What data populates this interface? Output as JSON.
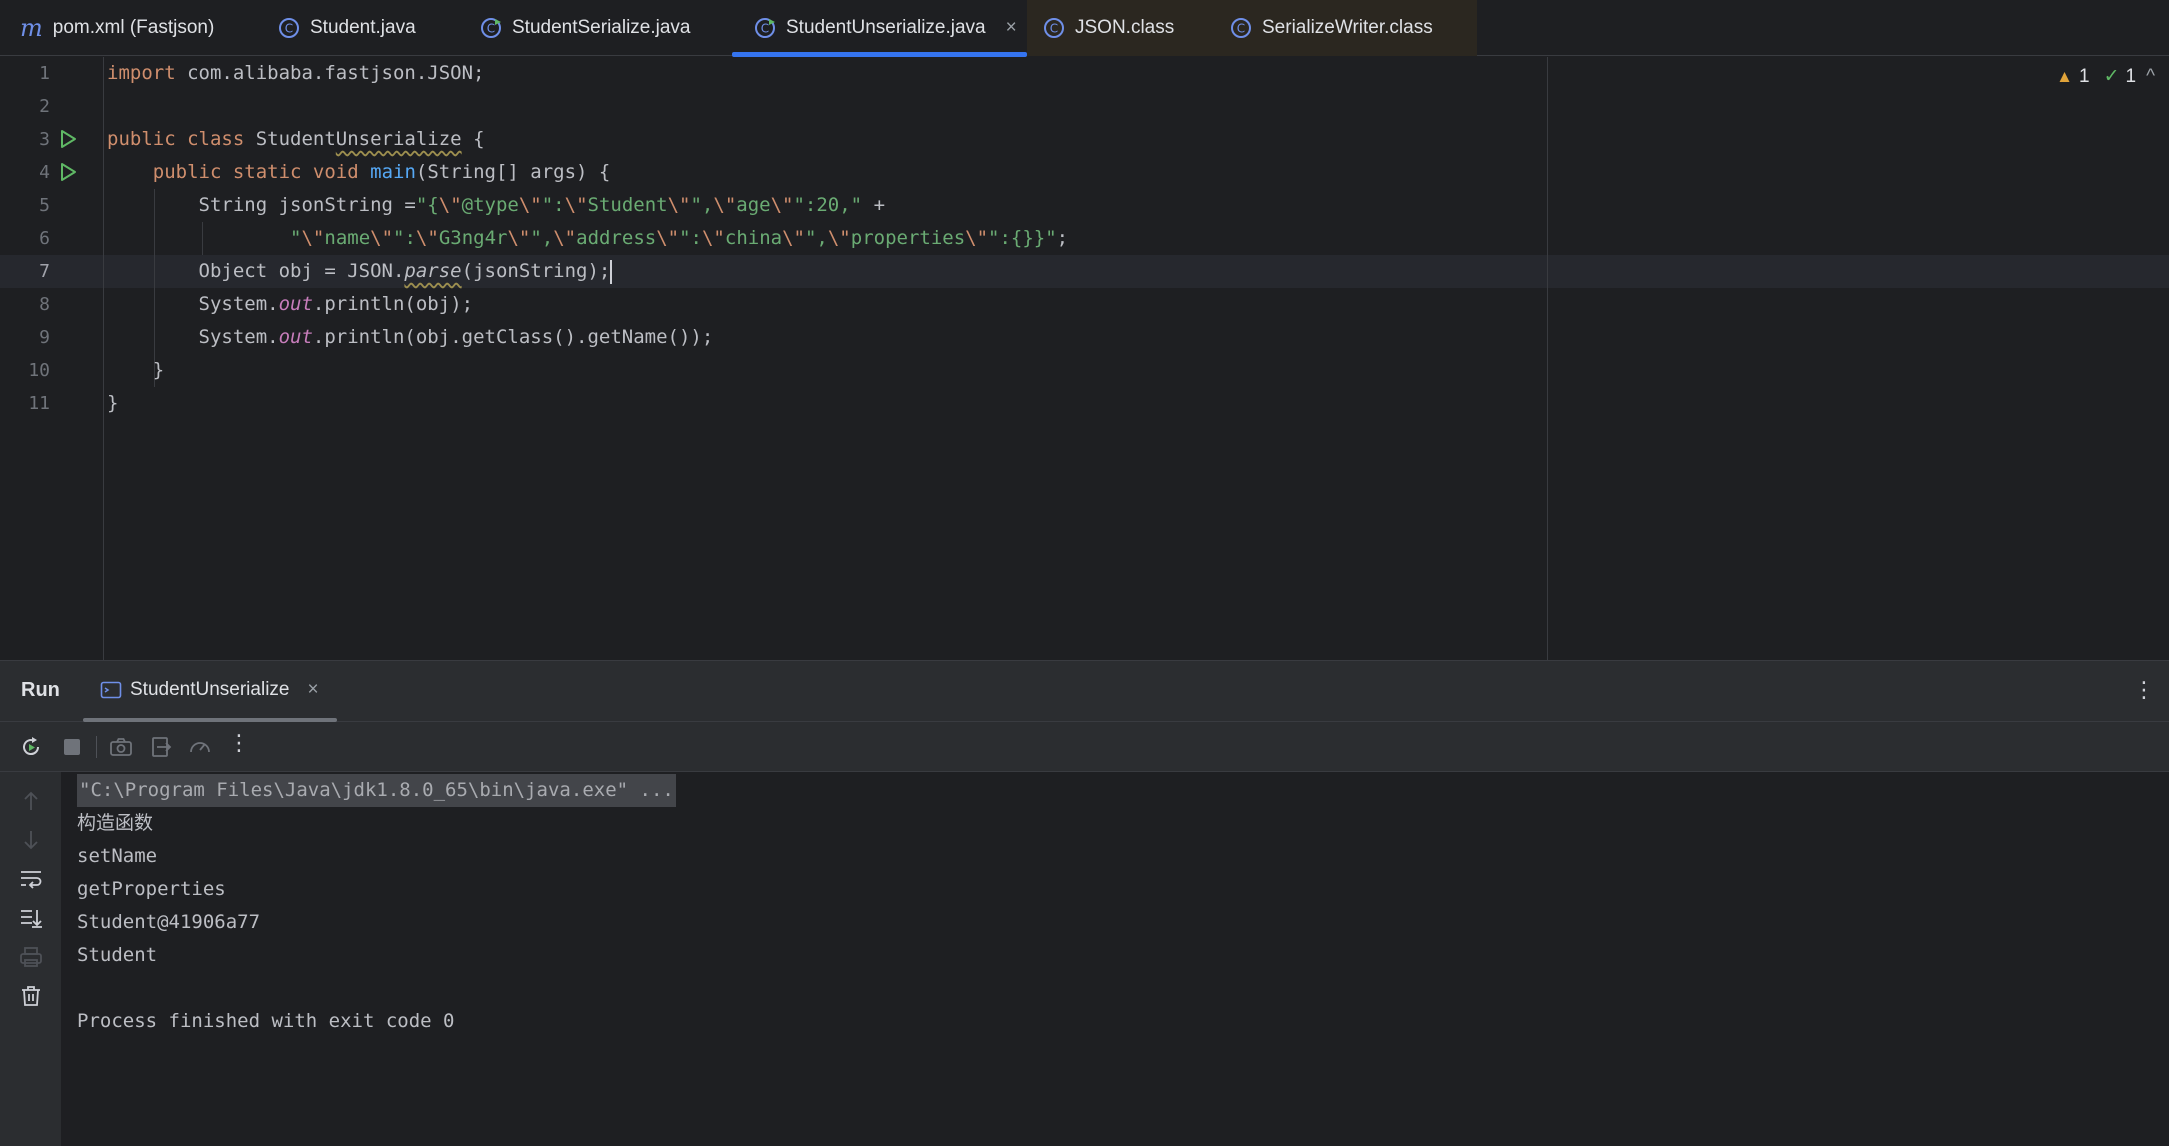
{
  "tabs": [
    {
      "label": "pom.xml (Fastjson)",
      "icon": "maven-icon",
      "active": false
    },
    {
      "label": "Student.java",
      "icon": "class-icon",
      "active": false
    },
    {
      "label": "StudentSerialize.java",
      "icon": "runnable-class-icon",
      "active": false
    },
    {
      "label": "StudentUnserialize.java",
      "icon": "runnable-class-icon",
      "active": true,
      "close": "×"
    },
    {
      "label": "JSON.class",
      "icon": "compiled-class-icon",
      "active": false
    },
    {
      "label": "SerializeWriter.class",
      "icon": "compiled-class-icon",
      "active": false
    }
  ],
  "editor": {
    "line_numbers": [
      "1",
      "2",
      "3",
      "4",
      "5",
      "6",
      "7",
      "8",
      "9",
      "10",
      "11"
    ],
    "current_line": 7,
    "inspections": {
      "warnings": "1",
      "weak_warnings": "1"
    },
    "code": {
      "l1_kw": "import",
      "l1_rest": " com.alibaba.fastjson.JSON;",
      "l3_kw": "public class",
      "l3_name_a": " Student",
      "l3_name_b": "Unserialize",
      "l3_rest": " {",
      "l4_kw": "public static void",
      "l4_fn": "main",
      "l4_rest": "(String[] args) {",
      "l5_a": "String jsonString =",
      "l5_s1": "\"{",
      "l5_e1": "\\\"",
      "l5_s2": "@type",
      "l5_e2": "\\\"",
      "l5_s3": "\":",
      "l5_e3": "\\\"",
      "l5_s4": "Student",
      "l5_e4": "\\\"",
      "l5_s5": "\",",
      "l5_e5": "\\\"",
      "l5_s6": "age",
      "l5_e6": "\\\"",
      "l5_s7": "\":20,\"",
      "l5_plus": " +",
      "l6_s1": "\"",
      "l6_e1": "\\\"",
      "l6_s2": "name",
      "l6_e2": "\\\"",
      "l6_s3": "\":",
      "l6_e3": "\\\"",
      "l6_s4": "G3ng4r",
      "l6_e4": "\\\"",
      "l6_s5": "\",",
      "l6_e5": "\\\"",
      "l6_s6": "address",
      "l6_e6": "\\\"",
      "l6_s7": "\":",
      "l6_e7": "\\\"",
      "l6_s8": "china",
      "l6_e8": "\\\"",
      "l6_s9": "\",",
      "l6_e9": "\\\"",
      "l6_s10": "properties",
      "l6_e10": "\\\"",
      "l6_s11": "\":{}}\"",
      "l6_end": ";",
      "l7_a": "Object obj = JSON.",
      "l7_fn": "parse",
      "l7_b": "(jsonString);",
      "l8_a": "System.",
      "l8_st": "out",
      "l8_b": ".println(obj);",
      "l9_a": "System.",
      "l9_st": "out",
      "l9_b": ".println(obj.getClass().getName());",
      "l10": "}",
      "l11": "}"
    }
  },
  "run": {
    "title": "Run",
    "tab_label": "StudentUnserialize",
    "tab_close": "×",
    "console": [
      "\"C:\\Program Files\\Java\\jdk1.8.0_65\\bin\\java.exe\" ...",
      "构造函数",
      "setName",
      "getProperties",
      "Student@41906a77",
      "Student",
      "",
      "Process finished with exit code 0"
    ]
  },
  "colors": {
    "accent": "#3574f0",
    "keyword": "#cf8e6d",
    "string": "#6aab73",
    "function": "#56a8f5",
    "static_field": "#c77dbb",
    "run_green": "#5fb865",
    "warning": "#e0a33a"
  }
}
